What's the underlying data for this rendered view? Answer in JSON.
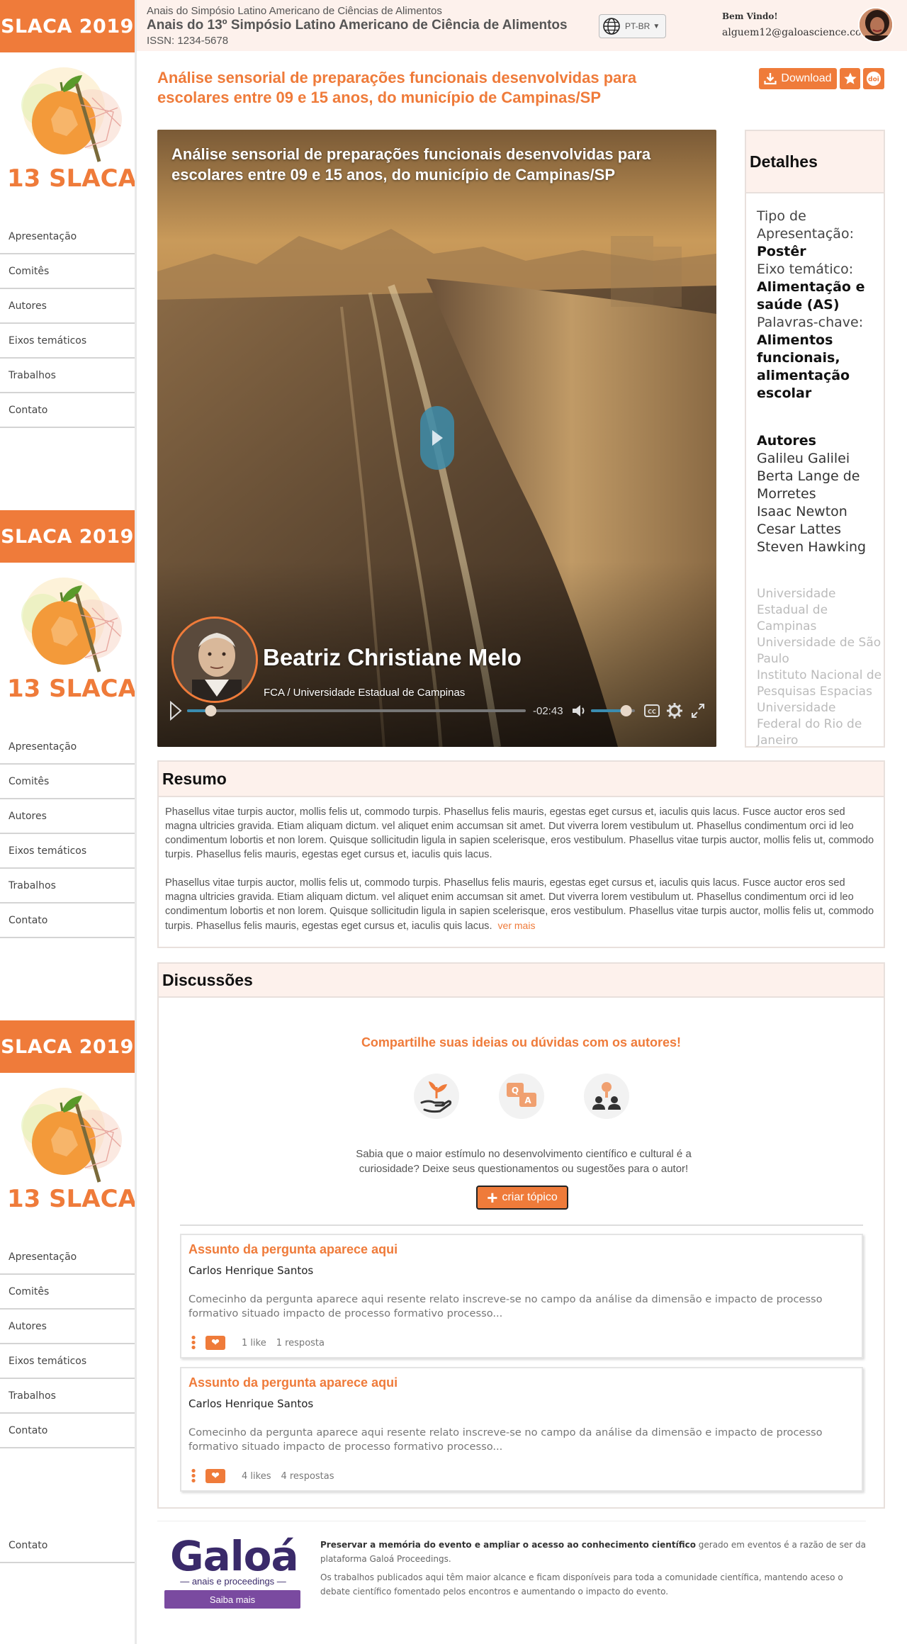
{
  "sidebar": {
    "brand": "SLACA 2019",
    "logo_text": "13 SLACA",
    "nav": [
      "Apresentação",
      "Comitês",
      "Autores",
      "Eixos temáticos",
      "Trabalhos",
      "Contato"
    ],
    "bottom_nav": "Contato"
  },
  "header": {
    "event_sub": "Anais do Simpósio Latino Americano de Ciências de Alimentos",
    "event_title": "Anais do 13º Simpósio Latino Americano de Ciência de Alimentos",
    "issn": "ISSN: 1234-5678",
    "language": "PT-BR",
    "welcome": "Bem Vindo!",
    "user_email": "alguem12@galoascience.com"
  },
  "paper": {
    "title": "Análise sensorial de preparações funcionais desenvolvidas para escolares entre 09 e 15 anos, do município de Campinas/SP",
    "download_label": "Download",
    "doi_label": "doi"
  },
  "video": {
    "title": "Análise sensorial de preparações funcionais desenvolvidas para escolares entre 09 e 15 anos, do município de Campinas/SP",
    "presenter_name": "Beatriz Christiane Melo",
    "presenter_affiliation": "FCA / Universidade Estadual de Campinas",
    "time_remaining": "-02:43",
    "progress": 0.07,
    "volume": 0.8
  },
  "details": {
    "heading": "Detalhes",
    "presentation_label": "Tipo de Apresentação:",
    "presentation_value": "Postêr",
    "theme_label": "Eixo temático:",
    "theme_value": "Alimentação e saúde (AS)",
    "keywords_label": "Palavras-chave:",
    "keywords_value": "Alimentos funcionais, alimentação escolar",
    "authors_heading": "Autores",
    "authors": [
      "Galileu Galilei",
      "Berta Lange de Morretes",
      "Isaac Newton",
      "Cesar Lattes",
      "Steven Hawking"
    ],
    "institutions": [
      "Universidade Estadual de Campinas",
      "Universidade de São Paulo",
      "Instituto Nacional de Pesquisas Espacias",
      "Universidade Federal do Rio de Janeiro"
    ]
  },
  "resumo": {
    "heading": "Resumo",
    "paragraphs": [
      "Phasellus vitae turpis auctor, mollis felis ut, commodo turpis. Phasellus felis mauris, egestas eget cursus et, iaculis quis lacus. Fusce auctor eros sed magna ultricies gravida. Etiam aliquam dictum. vel aliquet enim accumsan sit amet. Dut viverra lorem vestibulum ut. Phasellus condimentum orci id leo condimentum lobortis et non lorem. Quisque sollicitudin ligula in sapien scelerisque, eros vestibulum. Phasellus vitae turpis auctor, mollis felis ut, commodo turpis. Phasellus felis mauris, egestas eget cursus et, iaculis quis lacus.",
      "Phasellus vitae turpis auctor, mollis felis ut, commodo turpis. Phasellus felis mauris, egestas eget cursus et, iaculis quis lacus. Fusce auctor eros sed magna ultricies gravida. Etiam aliquam dictum. vel aliquet enim accumsan sit amet. Dut viverra lorem vestibulum ut. Phasellus condimentum orci id leo condimentum lobortis et non lorem. Quisque sollicitudin ligula in sapien scelerisque, eros vestibulum. Phasellus vitae turpis auctor, mollis felis ut, commodo turpis. Phasellus felis mauris, egestas eget cursus et, iaculis quis lacus."
    ],
    "more_label": "ver mais"
  },
  "discussions": {
    "heading": "Discussões",
    "share_title": "Compartilhe suas ideias ou dúvidas com os autores!",
    "share_text": "Sabia que o maior estímulo no desenvolvimento científico e cultural é a curiosidade? Deixe seus questionamentos ou sugestões para o autor!",
    "create_label": "criar tópico",
    "questions": [
      {
        "title": "Assunto da pergunta aparece aqui",
        "author": "Carlos Henrique Santos",
        "excerpt": "Comecinho da pergunta aparece aqui resente relato inscreve-se no campo da análise da dimensão e impacto de processo formativo situado impacto de processo formativo processo...",
        "likes": "1 like",
        "replies": "1 resposta"
      },
      {
        "title": "Assunto da pergunta aparece aqui",
        "author": "Carlos Henrique Santos",
        "excerpt": "Comecinho da pergunta aparece aqui resente relato inscreve-se no campo da análise da dimensão e impacto de processo formativo situado impacto de processo formativo processo...",
        "likes": "4 likes",
        "replies": "4 respostas"
      }
    ]
  },
  "footer": {
    "brand": "Galoá",
    "brand_sub": "anais e proceedings",
    "more_label": "Saiba mais",
    "line1_bold": "Preservar a memória do evento e ampliar o acesso ao conhecimento científico",
    "line1_rest": " gerado em eventos é a razão de ser da plataforma Galoá Proceedings.",
    "line2": "Os trabalhos publicados aqui têm maior alcance e ficam disponíveis para toda a comunidade científica, mantendo aceso o debate científico fomentado pelos encontros e aumentando o impacto do evento."
  },
  "colors": {
    "accent": "#ef7b3a",
    "header_bg": "#fdf1ec",
    "purple": "#7a4aa0"
  },
  "icons": [
    "globe-icon",
    "download-icon",
    "star-icon",
    "doi-icon",
    "play-icon",
    "volume-icon",
    "cc-icon",
    "settings-icon",
    "fullscreen-icon",
    "plant-hand-icon",
    "qa-icon",
    "people-icon",
    "heart-icon",
    "more-icon"
  ]
}
